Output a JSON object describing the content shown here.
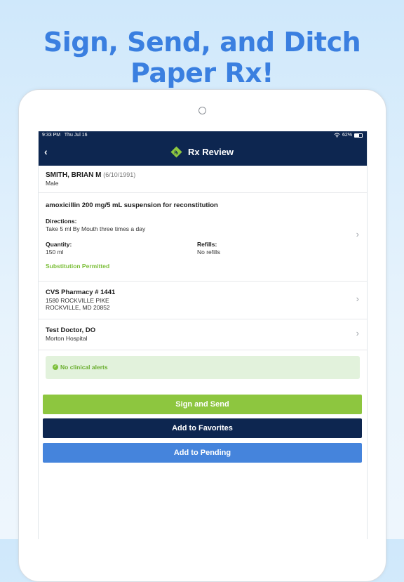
{
  "headline": "Sign, Send, and Ditch Paper Rx!",
  "status_bar": {
    "time": "9:33 PM",
    "date": "Thu Jul 16",
    "battery": "62%",
    "battery_level": 0.62
  },
  "nav": {
    "back_icon": "chevron-left-icon",
    "title": "Rx Review"
  },
  "patient": {
    "name": "SMITH, BRIAN M",
    "dob": "(6/10/1991)",
    "sex": "Male"
  },
  "prescription": {
    "drug": "amoxicillin 200 mg/5 mL suspension for reconstitution",
    "directions_label": "Directions:",
    "directions": "Take 5 ml By Mouth three times a day",
    "quantity_label": "Quantity:",
    "quantity": "150 ml",
    "refills_label": "Refills:",
    "refills": "No refills",
    "substitution": "Substitution Permitted"
  },
  "pharmacy": {
    "name": "CVS Pharmacy # 1441",
    "address1": "1580 ROCKVILLE PIKE",
    "address2": "ROCKVILLE, MD 20852"
  },
  "prescriber": {
    "name": "Test Doctor, DO",
    "org": "Morton Hospital"
  },
  "alerts": {
    "text": "No clinical alerts"
  },
  "buttons": {
    "sign": "Sign and Send",
    "favorites": "Add to Favorites",
    "pending": "Add to Pending"
  },
  "colors": {
    "navy": "#0d2650",
    "green": "#8dc63f",
    "blue": "#4584dc",
    "headline": "#3a7fe0"
  }
}
